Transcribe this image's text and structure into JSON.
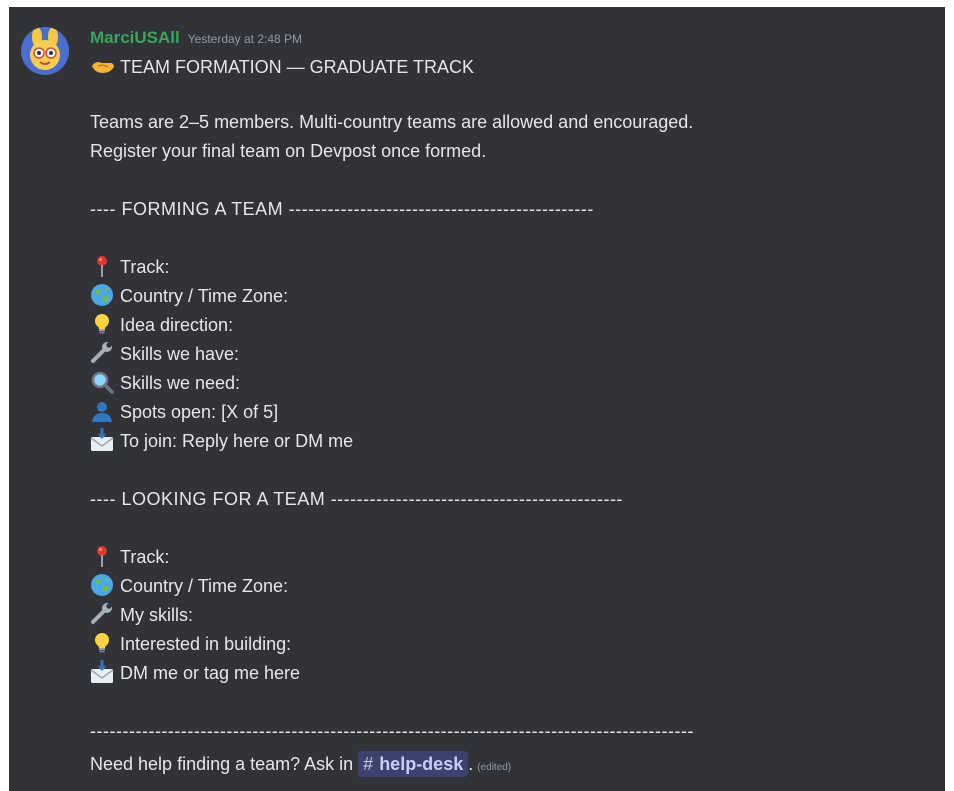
{
  "message": {
    "username": "MarciUSAll",
    "timestamp": "Yesterday at 2:48 PM",
    "title": "TEAM FORMATION —  GRADUATE TRACK",
    "intro": [
      "Teams are 2–5 members. Multi-country teams are allowed and encouraged.",
      "Register your final team on Devpost once formed."
    ],
    "forming": {
      "header": "---- FORMING A TEAM -----------------------------------------------",
      "items": [
        {
          "icon": "round-pushpin-icon",
          "text": "Track:"
        },
        {
          "icon": "globe-icon",
          "text": "Country / Time Zone:"
        },
        {
          "icon": "light-bulb-icon",
          "text": "Idea direction:"
        },
        {
          "icon": "wrench-icon",
          "text": "Skills we have:"
        },
        {
          "icon": "magnifying-glass-icon",
          "text": "Skills we need:"
        },
        {
          "icon": "bust-silhouette-icon",
          "text": "Spots open: [X of 5]"
        },
        {
          "icon": "envelope-with-arrow-icon",
          "text": "To join: Reply here or DM me"
        }
      ]
    },
    "looking": {
      "header": "---- LOOKING FOR A TEAM ---------------------------------------------",
      "items": [
        {
          "icon": "round-pushpin-icon",
          "text": "Track:"
        },
        {
          "icon": "globe-icon",
          "text": "Country / Time Zone:"
        },
        {
          "icon": "wrench-icon",
          "text": "My skills:"
        },
        {
          "icon": "light-bulb-icon",
          "text": "Interested in building:"
        },
        {
          "icon": "envelope-with-arrow-icon",
          "text": "DM me or tag me here"
        }
      ]
    },
    "divider": "---------------------------------------------------------------------------------------------",
    "footer_text": "Need help finding a team? Ask in ",
    "channel_name": "help-desk",
    "footer_period": ".",
    "edited_label": "(edited)",
    "title_icon": "handshake-icon"
  },
  "colors": {
    "background": "#313338",
    "username": "#3ba55c",
    "timestamp": "#949ba4",
    "text": "#dbdee1",
    "mention_bg": "#3c4270",
    "mention_text": "#c9cdfb"
  }
}
